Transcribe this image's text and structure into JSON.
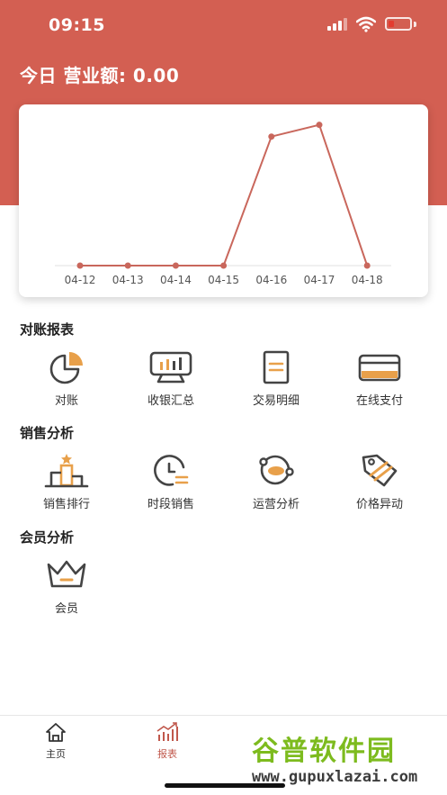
{
  "status_bar": {
    "time": "09:15"
  },
  "header": {
    "revenue_text": "今日 营业额: 0.00"
  },
  "chart_data": {
    "type": "line",
    "categories": [
      "04-12",
      "04-13",
      "04-14",
      "04-15",
      "04-16",
      "04-17",
      "04-18"
    ],
    "values": [
      0,
      0,
      0,
      0,
      4.95,
      5.4,
      0
    ],
    "ylim": [
      0,
      5.7
    ],
    "grid": false,
    "title": "",
    "xlabel": "",
    "ylabel": "",
    "line_color": "#c9675c"
  },
  "sections": {
    "reconciliation": {
      "title": "对账报表",
      "items": [
        {
          "label": "对账",
          "icon": "pie-chart-icon"
        },
        {
          "label": "收银汇总",
          "icon": "cash-register-icon"
        },
        {
          "label": "交易明细",
          "icon": "document-icon"
        },
        {
          "label": "在线支付",
          "icon": "card-icon"
        }
      ]
    },
    "sales": {
      "title": "销售分析",
      "items": [
        {
          "label": "销售排行",
          "icon": "podium-icon"
        },
        {
          "label": "时段销售",
          "icon": "clock-icon"
        },
        {
          "label": "运营分析",
          "icon": "orbit-icon"
        },
        {
          "label": "价格异动",
          "icon": "price-tag-icon"
        }
      ]
    },
    "members": {
      "title": "会员分析",
      "items": [
        {
          "label": "会员",
          "icon": "crown-icon"
        }
      ]
    }
  },
  "tabbar": {
    "tabs": [
      {
        "label": "主页",
        "icon": "home-icon"
      },
      {
        "label": "报表",
        "icon": "report-icon",
        "active": true
      }
    ]
  },
  "watermark": {
    "title": "谷普软件园",
    "url": "www.gupuxlazai.com"
  },
  "colors": {
    "brand": "#d35f52",
    "accent": "#e8a04a",
    "icon_dark": "#444444"
  }
}
